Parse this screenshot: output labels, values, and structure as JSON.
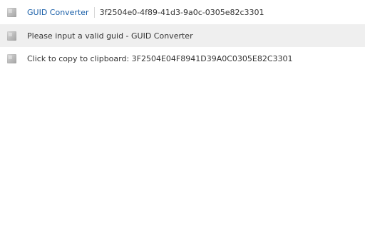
{
  "header": {
    "keyword": "GUID Converter",
    "input_value": "3f2504e0-4f89-41d3-9a0c-0305e82c3301",
    "icon": "extension-puzzle-icon"
  },
  "suggestions": [
    {
      "text": "Please input a valid guid - GUID Converter",
      "icon": "extension-puzzle-icon",
      "highlighted": true
    },
    {
      "text": "Click to copy to clipboard: 3F2504E04F8941D39A0C0305E82C3301",
      "icon": "extension-puzzle-icon",
      "highlighted": false
    }
  ],
  "colors": {
    "keyword": "#1a5fa8",
    "highlight_row": "#efefef",
    "text": "#333333"
  }
}
